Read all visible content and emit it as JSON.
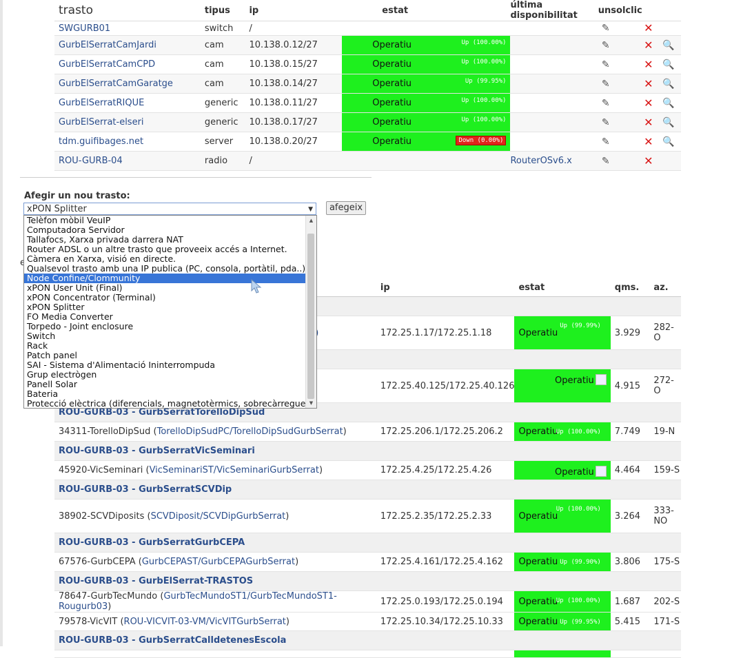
{
  "top_table": {
    "headers": {
      "trasto": "trasto",
      "tipus": "tipus",
      "ip": "ip",
      "estat": "estat",
      "ultima": "última disponibilitat",
      "unsolclic": "unsolclic"
    },
    "rows": [
      {
        "name": "SWGURB01",
        "tipus": "switch",
        "ip": "/",
        "status": "",
        "uptime": "",
        "firmware": ""
      },
      {
        "name": "GurbElSerratCamJardi",
        "tipus": "cam",
        "ip": "10.138.0.12/27",
        "status": "Operatiu",
        "uptime": "Up (100.00%)",
        "firmware": ""
      },
      {
        "name": "GurbElSerratCamCPD",
        "tipus": "cam",
        "ip": "10.138.0.15/27",
        "status": "Operatiu",
        "uptime": "Up (100.00%)",
        "firmware": ""
      },
      {
        "name": "GurbElSerratCamGaratge",
        "tipus": "cam",
        "ip": "10.138.0.14/27",
        "status": "Operatiu",
        "uptime": "Up (99.95%)",
        "firmware": ""
      },
      {
        "name": "GurbElSerratRIQUE",
        "tipus": "generic",
        "ip": "10.138.0.11/27",
        "status": "Operatiu",
        "uptime": "Up (100.00%)",
        "firmware": ""
      },
      {
        "name": "GurbElSerrat-elseri",
        "tipus": "generic",
        "ip": "10.138.0.17/27",
        "status": "Operatiu",
        "uptime": "Up (100.00%)",
        "firmware": ""
      },
      {
        "name": "tdm.guifibages.net",
        "tipus": "server",
        "ip": "10.138.0.20/27",
        "status": "Operatiu",
        "uptime": "Down (0.00%)",
        "firmware": ""
      },
      {
        "name": "ROU-GURB-04",
        "tipus": "radio",
        "ip": "/",
        "status": "",
        "uptime": "",
        "firmware": "RouterOSv6.x"
      }
    ]
  },
  "add_form": {
    "label": "Afegir un nou trasto:",
    "selected": "xPON Splitter",
    "button": "afegeix",
    "options": [
      "Telèfon mòbil VeuIP",
      "Computadora Servidor",
      "Tallafocs, Xarxa privada darrera NAT",
      "Router ADSL o un altre trasto que proveeix accés a Internet.",
      "Càmera en Xarxa, visió en directe.",
      "Qualsevol trasto amb una IP publica (PC, consola, portàtil, pda..)",
      "Node Confine/Clommunity",
      "xPON User Unit (Final)",
      "xPON Concentrator (Terminal)",
      "xPON Splitter",
      "FO Media Converter",
      "Torpedo - Joint enclosure",
      "Switch",
      "Rack",
      "Patch panel",
      "SAI - Sistema d'Alimentació Ininterrompuda",
      "Grup electrògen",
      "Panell Solar",
      "Bateria",
      "Protecció elèctrica (diferencials, magnetotèrmics, sobrecàrregues)"
    ],
    "highlighted_index": 6
  },
  "partial_text": {
    "hidden_heading_fragment": "e",
    "hidden_link_fragment": "5)"
  },
  "bottom_table": {
    "headers": {
      "ip": "ip",
      "estat": "estat",
      "qms": "qms.",
      "az": "az."
    },
    "groups": [
      {
        "title": "",
        "rows": [
          {
            "name": "",
            "link": "",
            "ip": "172.25.1.17/172.25.1.18",
            "status": "Operatiu",
            "uptime": "Up (99.99%)",
            "qms": "3.929",
            "az": "282-O"
          }
        ]
      },
      {
        "title": "",
        "rows": [
          {
            "name": "",
            "link": "",
            "ip": "172.25.40.125/172.25.40.126",
            "status": "Operatiu",
            "uptime": "",
            "qms": "4.915",
            "az": "272-O"
          }
        ]
      },
      {
        "title": "ROU-GURB-03 - GurbSerratTorelloDipSud",
        "rows": [
          {
            "name": "34311-TorelloDipSud",
            "link": "TorelloDipSudPC/TorelloDipSudGurbSerrat",
            "ip": "172.25.206.1/172.25.206.2",
            "status": "Operatiu",
            "uptime": "Up (100.00%)",
            "qms": "7.749",
            "az": "19-N"
          }
        ]
      },
      {
        "title": "ROU-GURB-03 - GurbSerratVicSeminari",
        "rows": [
          {
            "name": "45920-VicSeminari",
            "link": "VicSeminariST/VicSeminariGurbSerrat",
            "ip": "172.25.4.25/172.25.4.26",
            "status": "Operatiu",
            "uptime": "",
            "qms": "4.464",
            "az": "159-S"
          }
        ]
      },
      {
        "title": "ROU-GURB-03 - GurbSerratSCVDip",
        "rows": [
          {
            "name": "38902-SCVDiposits",
            "link": "SCVDiposit/SCVDipGurbSerrat",
            "ip": "172.25.2.35/172.25.2.33",
            "status": "Operatiu",
            "uptime": "Up (100.00%)",
            "qms": "3.264",
            "az": "333-NO"
          }
        ]
      },
      {
        "title": "ROU-GURB-03 - GurbSerratGurbCEPA",
        "rows": [
          {
            "name": "67576-GurbCEPA",
            "link": "GurbCEPAST/GurbCEPAGurbSerrat",
            "ip": "172.25.4.161/172.25.4.162",
            "status": "Operatiu",
            "uptime": "Up (99.90%)",
            "qms": "3.806",
            "az": "175-S"
          }
        ]
      },
      {
        "title": "ROU-GURB-03 - GurbElSerrat-TRASTOS",
        "rows": [
          {
            "name": "78647-GurbTecMundo",
            "link": "GurbTecMundoST1/GurbTecMundoST1-Rougurb03",
            "ip": "172.25.0.193/172.25.0.194",
            "status": "Operatiu",
            "uptime": "Up (100.00%)",
            "qms": "1.687",
            "az": "202-S"
          },
          {
            "name": "79578-VicVIT",
            "link": "ROU-VICVIT-03-VM/VicVITGurbSerrat",
            "ip": "172.25.10.34/172.25.10.33",
            "status": "Operatiu",
            "uptime": "Up (99.95%)",
            "qms": "5.415",
            "az": "171-S"
          }
        ]
      },
      {
        "title": "ROU-GURB-03 - GurbSerratCalldetenesEscola",
        "rows": []
      }
    ]
  },
  "colors": {
    "status_green": "#1ef01e",
    "down_red": "#e0251b",
    "link": "#2b4e8c",
    "highlight": "#3875d7"
  }
}
